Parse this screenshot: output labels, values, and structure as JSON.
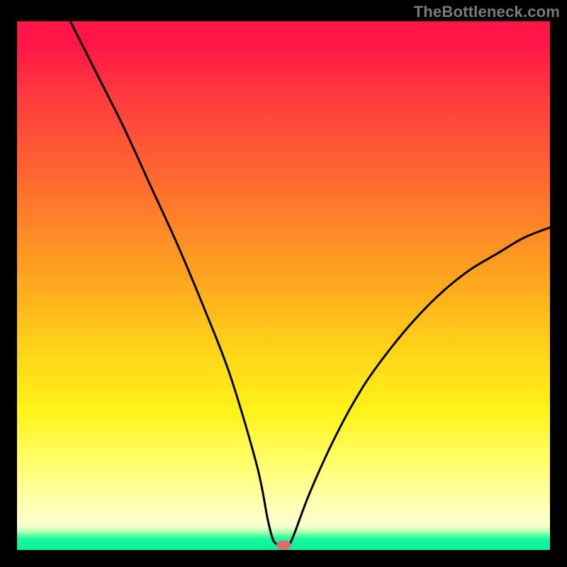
{
  "watermark": "TheBottleneck.com",
  "chart_data": {
    "type": "line",
    "title": "",
    "xlabel": "",
    "ylabel": "",
    "xlim": [
      0,
      100
    ],
    "ylim": [
      0,
      100
    ],
    "grid": false,
    "legend": false,
    "series": [
      {
        "name": "bottleneck-curve",
        "x": [
          10,
          15,
          20,
          25,
          30,
          35,
          40,
          45,
          47,
          48,
          49,
          50,
          51,
          52,
          55,
          60,
          65,
          70,
          75,
          80,
          85,
          90,
          95,
          100
        ],
        "values": [
          100,
          90,
          80,
          69,
          58,
          46,
          33,
          16,
          6,
          2,
          1,
          1,
          1,
          3,
          11,
          22,
          31,
          38,
          44,
          49,
          53,
          56,
          59,
          61
        ]
      }
    ],
    "marker": {
      "x": 50,
      "y": 1,
      "label": "optimal-point"
    },
    "colors": {
      "curve": "#000000",
      "marker": "#e26a6a",
      "gradient_top": "#ff1547",
      "gradient_bottom": "#0bf09a"
    }
  }
}
